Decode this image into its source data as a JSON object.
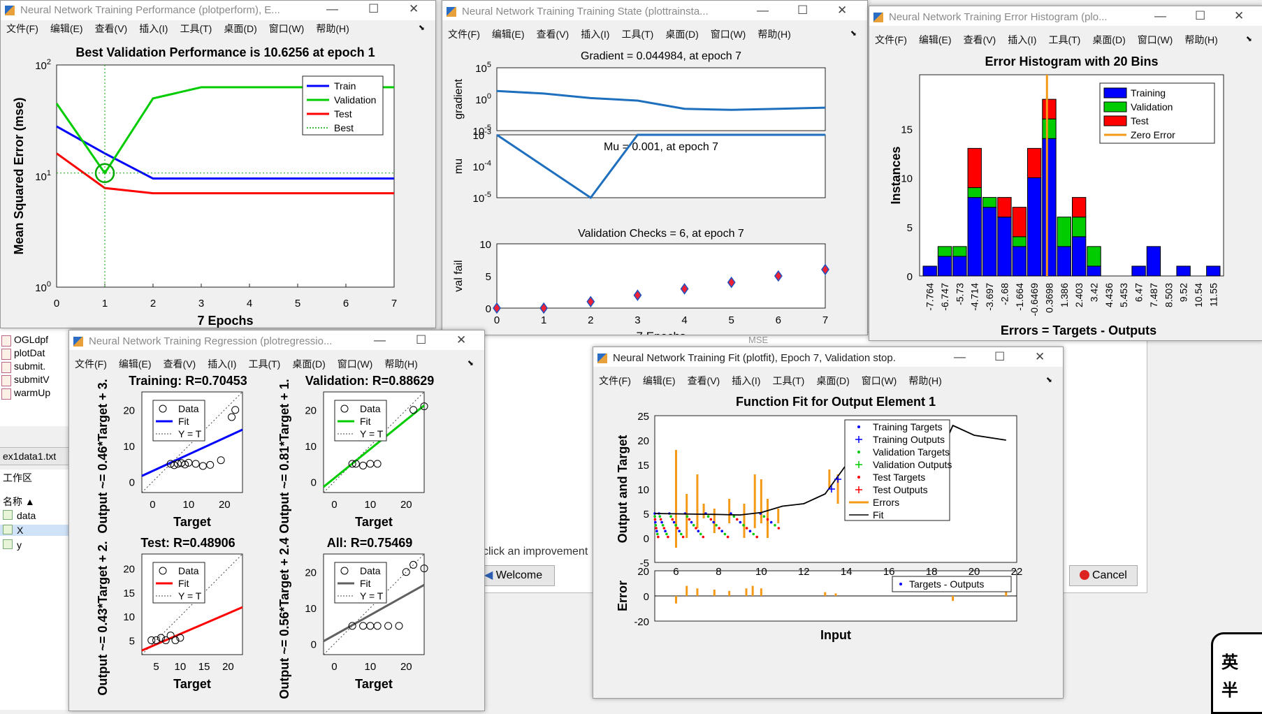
{
  "underlying": {
    "files": [
      "OGLdpf",
      "plotDat",
      "submit.",
      "submitV",
      "warmUp"
    ],
    "file_partial": "normal",
    "current_file": "ex1data1.txt",
    "workspace_title": "工作区",
    "ws_header": "名称 ▲",
    "ws_vars": [
      "data",
      "X",
      "y"
    ],
    "prompt_text": "click an improvement",
    "welcome_label": "Welcome",
    "cancel_label": "Cancel",
    "mse_text": "MSE",
    "side_fragments": [
      "e",
      "ir",
      "al",
      "if"
    ],
    "sticker_chars": [
      "英",
      "半"
    ]
  },
  "menus": [
    "文件(F)",
    "编辑(E)",
    "查看(V)",
    "插入(I)",
    "工具(T)",
    "桌面(D)",
    "窗口(W)",
    "帮助(H)"
  ],
  "windows": {
    "perform": {
      "title": "Neural Network Training Performance (plotperform), E..."
    },
    "trainstate": {
      "title": "Neural Network Training Training State (plottrainsta..."
    },
    "errhist": {
      "title": "Neural Network Training Error Histogram (plo..."
    },
    "regression": {
      "title": "Neural Network Training Regression (plotregressio..."
    },
    "fit": {
      "title": "Neural Network Training Fit (plotfit), Epoch 7, Validation stop."
    }
  },
  "perform": {
    "title": "Best Validation Performance is 10.6256 at epoch 1",
    "ylabel": "Mean Squared Error  (mse)",
    "xlabel": "7 Epochs",
    "xticks": [
      "0",
      "1",
      "2",
      "3",
      "4",
      "5",
      "6",
      "7"
    ],
    "yticks": [
      {
        "b": "10",
        "e": "0"
      },
      {
        "b": "10",
        "e": "1"
      },
      {
        "b": "10",
        "e": "2"
      }
    ],
    "legend": [
      "Train",
      "Validation",
      "Test",
      "Best"
    ],
    "colors": {
      "train": "#0000ff",
      "validation": "#00cc00",
      "test": "#ff0000",
      "best": "#00aa00"
    }
  },
  "trainstate": {
    "gradient_title": "Gradient = 0.044984, at epoch 7",
    "mu_title": "Mu = 0.001, at epoch 7",
    "val_title": "Validation Checks = 6, at epoch 7",
    "ylabels": [
      "gradient",
      "mu",
      "val fail"
    ],
    "grad_ticks": [
      {
        "b": "10",
        "e": "5"
      },
      {
        "b": "10",
        "e": "0"
      },
      {
        "b": "10",
        "e": "-5"
      }
    ],
    "mu_ticks": [
      {
        "b": "10",
        "e": "-3"
      },
      {
        "b": "10",
        "e": "-4"
      },
      {
        "b": "10",
        "e": "-5"
      }
    ],
    "val_ticks": [
      "10",
      "5",
      "0"
    ],
    "xticks": [
      "0",
      "1",
      "2",
      "3",
      "4",
      "5",
      "6",
      "7"
    ],
    "xlabel": "7 Epochs"
  },
  "errhist": {
    "title": "Error Histogram with 20 Bins",
    "ylabel": "Instances",
    "xlabel": "Errors = Targets - Outputs",
    "yticks": [
      "0",
      "5",
      "10",
      "15"
    ],
    "legend": [
      "Training",
      "Validation",
      "Test",
      "Zero Error"
    ]
  },
  "regression": {
    "panels": [
      {
        "title": "Training: R=0.70453",
        "ylabel": "Output ~= 0.46*Target + 3.",
        "fit_color": "#0000ff",
        "yticks": [
          "0",
          "10",
          "20"
        ],
        "xticks": [
          "0",
          "10",
          "20"
        ],
        "xlabel": "Target"
      },
      {
        "title": "Validation: R=0.88629",
        "ylabel": "Output ~= 0.81*Target + 1.",
        "fit_color": "#00cc00",
        "yticks": [
          "0",
          "10",
          "20"
        ],
        "xticks": [
          "0",
          "10",
          "20"
        ],
        "xlabel": "Target"
      },
      {
        "title": "Test: R=0.48906",
        "ylabel": "Output ~= 0.43*Target + 2.",
        "fit_color": "#ff0000",
        "yticks": [
          "5",
          "10",
          "15",
          "20"
        ],
        "xticks": [
          "5",
          "10",
          "15",
          "20"
        ],
        "xlabel": "Target"
      },
      {
        "title": "All: R=0.75469",
        "ylabel": "Output ~= 0.56*Target + 2.4",
        "fit_color": "#606060",
        "yticks": [
          "0",
          "10",
          "20"
        ],
        "xticks": [
          "0",
          "10",
          "20"
        ],
        "xlabel": "Target"
      }
    ],
    "legend": [
      "Data",
      "Fit",
      "Y = T"
    ]
  },
  "fit": {
    "title": "Function Fit for Output Element 1",
    "ylabel": "Output and Target",
    "ylabel2": "Error",
    "xlabel": "Input",
    "yticks": [
      "25",
      "20",
      "15",
      "10",
      "5",
      "0",
      "-5"
    ],
    "yticks2": [
      "20",
      "0",
      "-20"
    ],
    "xticks": [
      "6",
      "8",
      "10",
      "12",
      "14",
      "16",
      "18",
      "20",
      "22"
    ],
    "legend": [
      "Training Targets",
      "Training Outputs",
      "Validation Targets",
      "Validation Outputs",
      "Test Targets",
      "Test Outputs",
      "Errors",
      "Fit"
    ],
    "legend2": "Targets - Outputs"
  },
  "chart_data": [
    {
      "type": "line",
      "title": "Best Validation Performance is 10.6256 at epoch 1",
      "xlabel": "7 Epochs",
      "ylabel": "Mean Squared Error  (mse)",
      "yscale": "log",
      "xlim": [
        0,
        7
      ],
      "ylim": [
        1,
        100
      ],
      "x": [
        0,
        1,
        2,
        3,
        4,
        5,
        6,
        7
      ],
      "series": [
        {
          "name": "Train",
          "values": [
            28,
            16,
            9.5,
            9.5,
            9.5,
            9.5,
            9.5,
            9.5
          ]
        },
        {
          "name": "Validation",
          "values": [
            45,
            10.6256,
            50,
            63,
            63,
            63,
            63,
            63
          ]
        },
        {
          "name": "Test",
          "values": [
            16,
            7.8,
            7,
            7,
            7,
            7,
            7,
            7
          ]
        }
      ],
      "best_epoch": 1,
      "legend": "top-right"
    },
    {
      "type": "line",
      "title": "Gradient = 0.044984, at epoch 7",
      "ylabel": "gradient",
      "yscale": "log",
      "x": [
        0,
        1,
        2,
        3,
        4,
        5,
        6,
        7
      ],
      "values": [
        20,
        8,
        1.5,
        0.6,
        0.03,
        0.02,
        0.03,
        0.044984
      ]
    },
    {
      "type": "line",
      "title": "Mu = 0.001, at epoch 7",
      "ylabel": "mu",
      "yscale": "log",
      "x": [
        0,
        1,
        2,
        3,
        4,
        5,
        6,
        7
      ],
      "values": [
        0.001,
        0.0001,
        1e-05,
        0.001,
        0.001,
        0.001,
        0.001,
        0.001
      ]
    },
    {
      "type": "scatter",
      "title": "Validation Checks = 6, at epoch 7",
      "ylabel": "val fail",
      "xlabel": "7 Epochs",
      "ylim": [
        0,
        10
      ],
      "x": [
        0,
        1,
        2,
        3,
        4,
        5,
        6,
        7
      ],
      "values": [
        0,
        0,
        1,
        2,
        3,
        4,
        5,
        6
      ]
    },
    {
      "type": "bar",
      "title": "Error Histogram with 20 Bins",
      "xlabel": "Errors = Targets - Outputs",
      "ylabel": "Instances",
      "ylim": [
        0,
        20
      ],
      "categories": [
        "-7.764",
        "-6.747",
        "-5.73",
        "-4.714",
        "-3.697",
        "-2.68",
        "-1.664",
        "-0.6469",
        "0.3698",
        "1.386",
        "2.403",
        "3.42",
        "4.436",
        "5.453",
        "6.47",
        "7.487",
        "8.503",
        "9.52",
        "10.54",
        "11.55"
      ],
      "series": [
        {
          "name": "Training",
          "values": [
            1,
            2,
            2,
            8,
            7,
            6,
            3,
            10,
            14,
            3,
            4,
            1,
            0,
            0,
            1,
            3,
            0,
            1,
            0,
            1
          ]
        },
        {
          "name": "Validation",
          "values": [
            0,
            1,
            1,
            1,
            1,
            0,
            1,
            0,
            2,
            3,
            2,
            2,
            0,
            0,
            0,
            0,
            0,
            0,
            0,
            0
          ]
        },
        {
          "name": "Test",
          "values": [
            0,
            0,
            0,
            4,
            0,
            2,
            3,
            3,
            2,
            0,
            2,
            0,
            0,
            0,
            0,
            0,
            0,
            0,
            0,
            0
          ]
        }
      ],
      "zero_error_bin": "0.3698",
      "legend": "top-right"
    },
    {
      "type": "scatter",
      "title": "Training: R=0.70453",
      "xlabel": "Target",
      "ylabel": "Output ~= 0.46*Target + 3.",
      "fit": {
        "slope": 0.46,
        "intercept": 3
      },
      "points": [
        [
          5,
          5
        ],
        [
          6,
          4.6
        ],
        [
          7,
          5
        ],
        [
          8,
          5.2
        ],
        [
          9,
          4.8
        ],
        [
          10,
          5.3
        ],
        [
          12,
          5
        ],
        [
          14,
          4.4
        ],
        [
          16,
          4.7
        ],
        [
          19,
          6
        ],
        [
          22,
          18
        ],
        [
          23,
          20
        ]
      ]
    },
    {
      "type": "scatter",
      "title": "Validation: R=0.88629",
      "xlabel": "Target",
      "ylabel": "Output ~= 0.81*Target + 1.",
      "fit": {
        "slope": 0.81,
        "intercept": 1
      },
      "points": [
        [
          5,
          5
        ],
        [
          6,
          5
        ],
        [
          8,
          4.5
        ],
        [
          10,
          5
        ],
        [
          12,
          5
        ],
        [
          22,
          20
        ],
        [
          25,
          21
        ]
      ]
    },
    {
      "type": "scatter",
      "title": "Test: R=0.48906",
      "xlabel": "Target",
      "ylabel": "Output ~= 0.43*Target + 2.",
      "fit": {
        "slope": 0.43,
        "intercept": 2
      },
      "points": [
        [
          4,
          5
        ],
        [
          5,
          5
        ],
        [
          6,
          5.5
        ],
        [
          7,
          5
        ],
        [
          8,
          6
        ],
        [
          9,
          5
        ],
        [
          10,
          5.5
        ]
      ]
    },
    {
      "type": "scatter",
      "title": "All: R=0.75469",
      "xlabel": "Target",
      "ylabel": "Output ~= 0.56*Target + 2.4",
      "fit": {
        "slope": 0.56,
        "intercept": 2.4
      },
      "points": [
        [
          5,
          5
        ],
        [
          8,
          5
        ],
        [
          10,
          5
        ],
        [
          12,
          5
        ],
        [
          15,
          5
        ],
        [
          18,
          5
        ],
        [
          20,
          20
        ],
        [
          22,
          22
        ],
        [
          25,
          21
        ]
      ]
    },
    {
      "type": "line",
      "title": "Function Fit for Output Element 1",
      "xlabel": "Input",
      "ylabel": "Output and Target",
      "xlim": [
        5,
        22
      ],
      "ylim": [
        -5,
        25
      ],
      "fit_curve": [
        [
          5,
          5
        ],
        [
          8,
          4.8
        ],
        [
          9,
          4.7
        ],
        [
          10,
          5.2
        ],
        [
          11,
          6.5
        ],
        [
          12,
          7
        ],
        [
          13,
          9
        ],
        [
          13.5,
          12
        ],
        [
          14,
          15
        ],
        [
          14.5,
          14
        ],
        [
          15,
          11
        ],
        [
          16,
          8
        ],
        [
          17,
          9
        ],
        [
          18,
          13
        ],
        [
          19,
          23
        ],
        [
          20,
          21
        ],
        [
          21.5,
          20
        ]
      ],
      "legend": "top-right"
    }
  ]
}
